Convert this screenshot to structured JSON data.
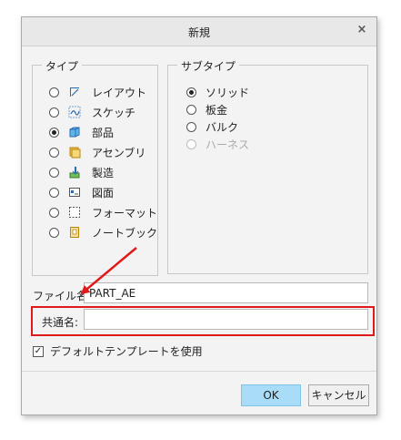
{
  "dialog": {
    "title": "新規",
    "close_glyph": "×"
  },
  "type_group": {
    "legend": "タイプ",
    "items": [
      {
        "label": "レイアウト",
        "icon": "layout-icon",
        "selected": false
      },
      {
        "label": "スケッチ",
        "icon": "sketch-icon",
        "selected": false
      },
      {
        "label": "部品",
        "icon": "part-icon",
        "selected": true
      },
      {
        "label": "アセンブリ",
        "icon": "assembly-icon",
        "selected": false
      },
      {
        "label": "製造",
        "icon": "manufacturing-icon",
        "selected": false
      },
      {
        "label": "図面",
        "icon": "drawing-icon",
        "selected": false
      },
      {
        "label": "フォーマット",
        "icon": "format-icon",
        "selected": false
      },
      {
        "label": "ノートブック",
        "icon": "notebook-icon",
        "selected": false
      }
    ]
  },
  "subtype_group": {
    "legend": "サブタイプ",
    "items": [
      {
        "label": "ソリッド",
        "selected": true,
        "disabled": false
      },
      {
        "label": "板金",
        "selected": false,
        "disabled": false
      },
      {
        "label": "バルク",
        "selected": false,
        "disabled": false
      },
      {
        "label": "ハーネス",
        "selected": false,
        "disabled": true
      }
    ]
  },
  "filename": {
    "label": "ファイル名:",
    "value": "PART_AE"
  },
  "common_name": {
    "label": "共通名:",
    "value": ""
  },
  "default_template": {
    "label": "デフォルトテンプレートを使用",
    "checked": true,
    "check_glyph": "✓"
  },
  "buttons": {
    "ok": "OK",
    "cancel": "キャンセル"
  },
  "colors": {
    "highlight": "#e01a1a",
    "ok_button": "#a9dcf7"
  }
}
